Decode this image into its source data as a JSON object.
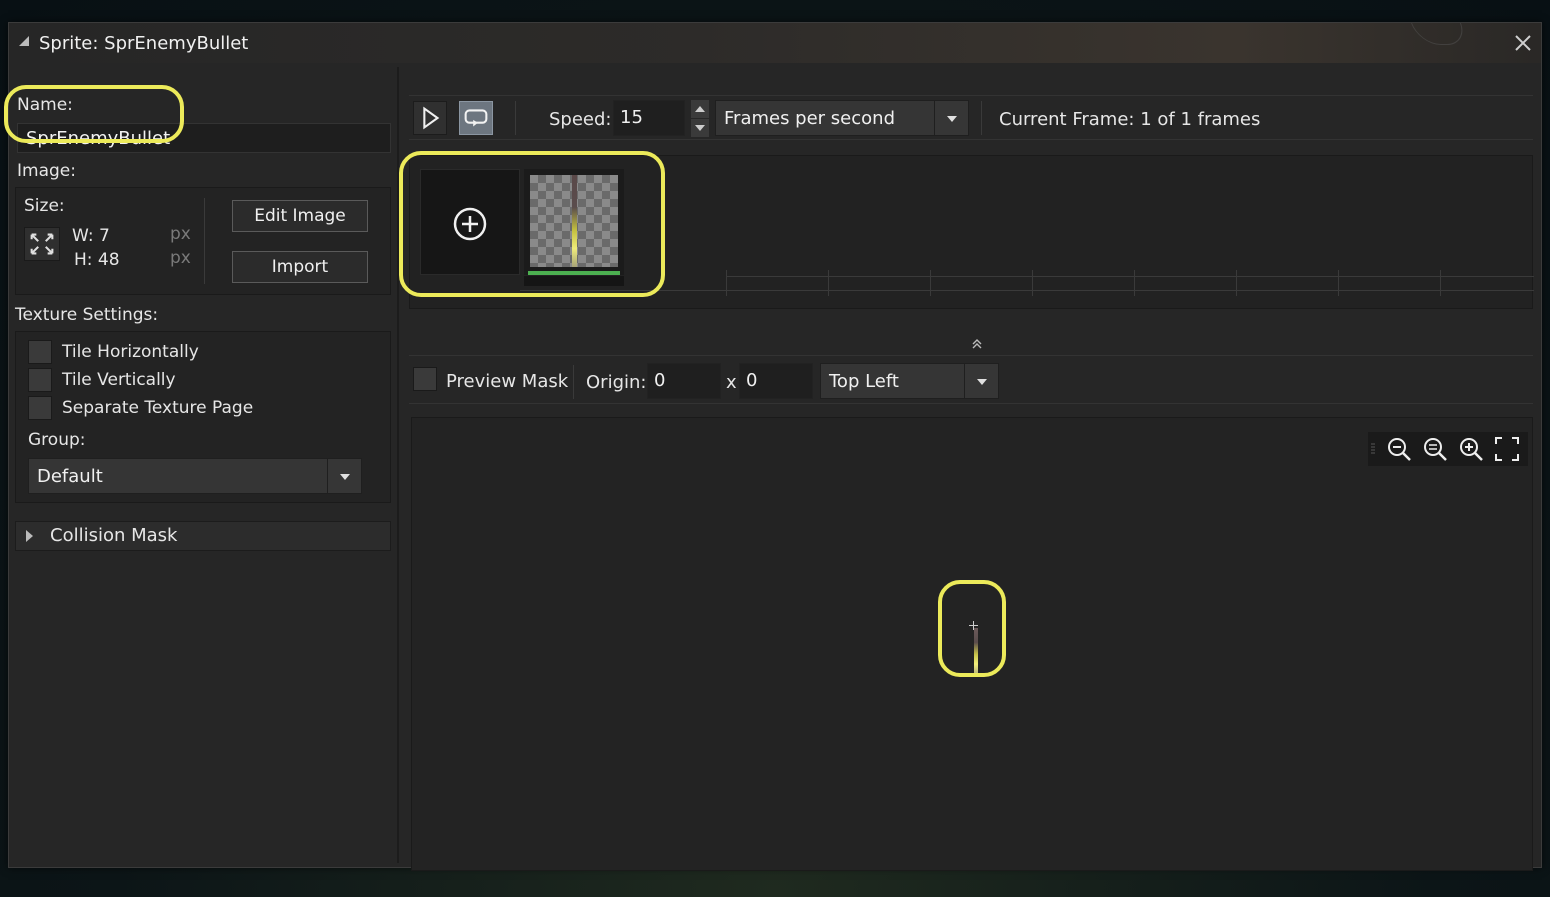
{
  "window": {
    "title": "Sprite: SprEnemyBullet"
  },
  "left": {
    "name_label": "Name:",
    "name_value": "SprEnemyBullet",
    "image_label": "Image:",
    "size_label": "Size:",
    "width_text": "W: 7",
    "height_text": "H: 48",
    "px_unit": "px",
    "edit_image_button": "Edit Image",
    "import_button": "Import",
    "texture_settings_label": "Texture Settings:",
    "tile_horizontally": "Tile Horizontally",
    "tile_vertically": "Tile Vertically",
    "separate_texture_page": "Separate Texture Page",
    "group_label": "Group:",
    "group_value": "Default",
    "collision_mask": "Collision Mask"
  },
  "toolbar": {
    "speed_label": "Speed:",
    "speed_value": "15",
    "speed_unit": "Frames per second",
    "current_frame": "Current Frame: 1 of 1 frames"
  },
  "preview_bar": {
    "preview_mask_label": "Preview Mask",
    "origin_label": "Origin:",
    "origin_x": "0",
    "origin_sep": "x",
    "origin_y": "0",
    "origin_preset": "Top Left"
  },
  "colors": {
    "highlight": "#ecea5a",
    "frame_indicator": "#4caf50",
    "window_bg": "#262626"
  },
  "icons": [
    "play-icon",
    "loop-icon",
    "add-frame-icon",
    "zoom-out-icon",
    "zoom-reset-icon",
    "zoom-in-icon",
    "fit-screen-icon",
    "close-icon",
    "resize-icon"
  ]
}
